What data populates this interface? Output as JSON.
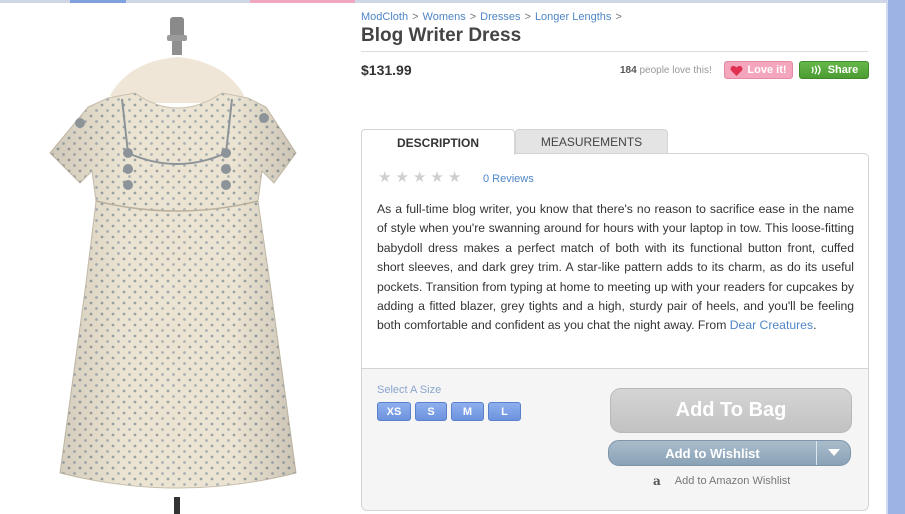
{
  "breadcrumb": {
    "items": [
      "ModCloth",
      "Womens",
      "Dresses",
      "Longer Lengths"
    ],
    "separator": ">"
  },
  "product": {
    "title": "Blog Writer Dress",
    "price": "$131.99",
    "love_count": "184",
    "love_text": "people love this!",
    "love_button": "Love it!",
    "share_button": "Share"
  },
  "tabs": [
    {
      "label": "DESCRIPTION",
      "active": true
    },
    {
      "label": "MEASUREMENTS",
      "active": false
    }
  ],
  "reviews": {
    "rating": 0,
    "max": 5,
    "link": "0 Reviews"
  },
  "description": {
    "text": "As a full-time blog writer, you know that there's no reason to sacrifice ease in the name of style when you're swanning around for hours with your laptop in tow. This loose-fitting babydoll dress makes a perfect match of both with its functional button front, cuffed short sleeves, and dark grey trim. A star-like pattern adds to its charm, as do its useful pockets. Transition from typing at home to meeting up with your readers for cupcakes by adding a fitted blazer, grey tights and a high, sturdy pair of heels, and you'll be feeling both comfortable and confident as you chat the night away. From ",
    "brand_link": "Dear Creatures",
    "end": "."
  },
  "purchase": {
    "size_label": "Select A Size",
    "sizes": [
      "XS",
      "S",
      "M",
      "L"
    ],
    "add_to_bag": "Add To Bag",
    "add_to_wishlist": "Add to Wishlist",
    "amazon_wishlist": "Add to Amazon Wishlist"
  },
  "colors": {
    "link": "#4f86c6",
    "love": "#f4a6bd",
    "share": "#5aab3e",
    "size": "#7b9ee6",
    "side_strip": "#9db3e3"
  },
  "icons": {
    "heart": "heart-icon",
    "share": "share-waves-icon",
    "star": "star-icon",
    "dropdown": "chevron-down-icon",
    "amazon": "amazon-logo-icon"
  }
}
